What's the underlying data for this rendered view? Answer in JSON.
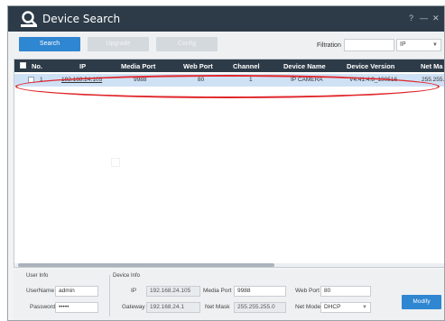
{
  "window": {
    "title": "Device Search",
    "help_glyph": "?",
    "minimize_glyph": "—",
    "close_glyph": "✕",
    "title_icon": "search-magnifier-icon"
  },
  "toolbar": {
    "search_label": "Search",
    "upgrade_label": "Upgrade",
    "config_label": "Config",
    "filtration_label": "Filtration",
    "filtration_value": "",
    "filter_type": "IP",
    "chevron": "▼"
  },
  "table": {
    "headers": {
      "no": "No.",
      "ip": "IP",
      "media_port": "Media Port",
      "web_port": "Web Port",
      "channel": "Channel",
      "device_name": "Device Name",
      "device_version": "Device Version",
      "net_mask": "Net Ma"
    },
    "rows": [
      {
        "no": "1",
        "ip": "192.168.24.105",
        "media_port": "9988",
        "web_port": "80",
        "channel": "1",
        "device_name": "IP CAMERA",
        "device_version": "V4.41.4.8_190516",
        "net_mask": "255.255."
      }
    ]
  },
  "user_info": {
    "section_label": "User Info",
    "username_label": "UserName",
    "username_value": "admin",
    "password_label": "Password",
    "password_value": "•••••"
  },
  "device_info": {
    "section_label": "Device Info",
    "ip_label": "IP",
    "ip_value": "192.168.24.105",
    "media_port_label": "Media Port",
    "media_port_value": "9988",
    "web_port_label": "Web Port",
    "web_port_value": "80",
    "gateway_label": "Gateway",
    "gateway_value": "192.168.24.1",
    "net_mask_label": "Net Mask",
    "net_mask_value": "255.255.255.0",
    "net_mode_label": "Net Mode",
    "net_mode_value": "DHCP",
    "chevron": "▼",
    "modify_label": "Modify"
  },
  "colors": {
    "titlebar": "#2d3b48",
    "accent": "#2f86d1",
    "selected_row": "#cfe1f5",
    "highlight_oval": "#e0262b"
  }
}
